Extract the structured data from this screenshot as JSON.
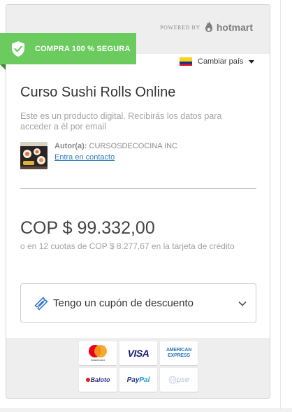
{
  "header": {
    "powered_by": "POWERED BY",
    "brand": "hotmart"
  },
  "badge": {
    "text": "COMPRA 100 % SEGURA"
  },
  "country": {
    "label": "Cambiar país"
  },
  "product": {
    "title": "Curso Sushi Rolls Online",
    "description": "Este es un producto digital. Recibirás los datos para acceder a él por email",
    "author_prefix": "Autor(a):",
    "author_name": "CURSOSDECOCINA INC",
    "contact_label": "Entra en contacto"
  },
  "pricing": {
    "price": "COP $ 99.332,00",
    "installments": "o en 12 cuotas de COP $ 8.277,67 en la tarjeta de crédito"
  },
  "coupon": {
    "label": "Tengo un cupón de descuento"
  },
  "payment_methods": {
    "mastercard_label": "mastercard",
    "visa": "VISA",
    "amex_line1": "AMERICAN",
    "amex_line2": "EXPRESS",
    "baloto": "Baloto",
    "paypal_1": "Pay",
    "paypal_2": "Pal",
    "pse": "pse"
  },
  "colors": {
    "secure_green": "#6ccb5f",
    "link_blue": "#2d7fb8",
    "coupon_icon_blue": "#3a78c9"
  }
}
